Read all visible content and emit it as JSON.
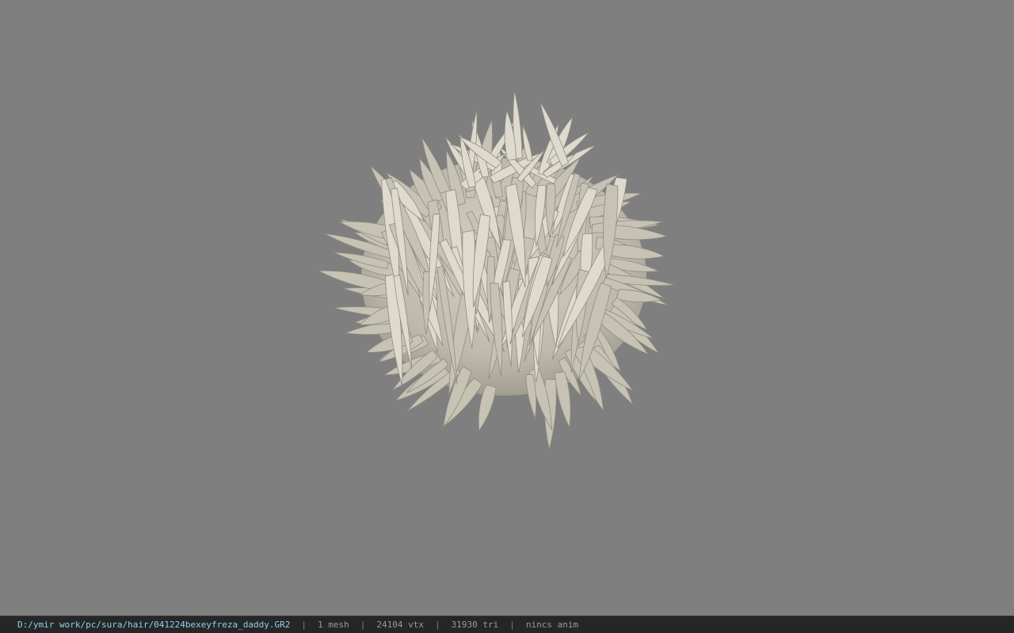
{
  "viewport": {
    "background": "#7f7f7f",
    "model": {
      "icon": "hair-mesh-render",
      "base_color": "#c6c2b4",
      "shade_color": "#8f8b80",
      "highlight_color": "#dedace"
    }
  },
  "statusbar": {
    "file_path": "D:/ymir work/pc/sura/hair/041224bexeyfreza_daddy.GR2",
    "separator": "|",
    "mesh_count": "1 mesh",
    "vertex_count": "24104 vtx",
    "triangle_count": "31930 tri",
    "anim_status": "nincs anim",
    "path_color": "#8fd0ee"
  }
}
